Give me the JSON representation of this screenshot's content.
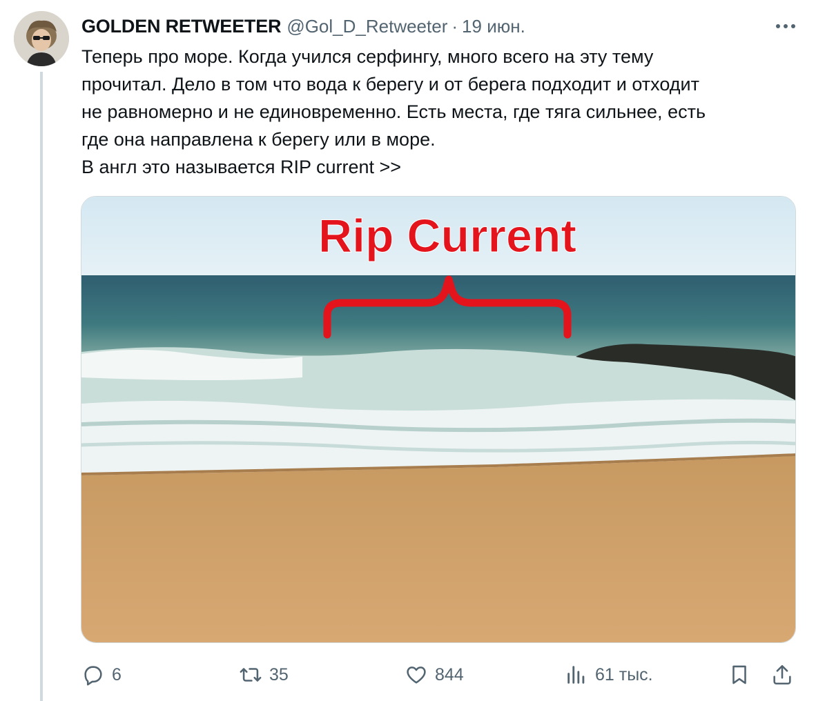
{
  "author": {
    "name": "GOLDEN RETWEETER",
    "handle": "@Gol_D_Retweeter",
    "separator": "·",
    "date": "19 июн."
  },
  "tweet": {
    "lines": [
      "Теперь про море. Когда учился серфингу, много всего на эту тему",
      "прочитал. Дело в том что вода к берегу и от берега подходит и отходит",
      "не равномерно и не единовременно. Есть места, где тяга сильнее, есть",
      "где она направлена к берегу или в море.",
      "В англ это называется RIP current >>"
    ]
  },
  "media": {
    "overlay_text": "Rip Current",
    "overlay_color": "#e3141c"
  },
  "actions": {
    "reply": {
      "icon": "reply-icon",
      "count": "6"
    },
    "retweet": {
      "icon": "retweet-icon",
      "count": "35"
    },
    "like": {
      "icon": "heart-icon",
      "count": "844"
    },
    "views": {
      "icon": "views-icon",
      "count": "61 тыс."
    },
    "bookmark": {
      "icon": "bookmark-icon"
    },
    "share": {
      "icon": "share-icon"
    }
  },
  "colors": {
    "text_primary": "#0f1419",
    "text_secondary": "#536471",
    "border": "#cfd9de"
  }
}
